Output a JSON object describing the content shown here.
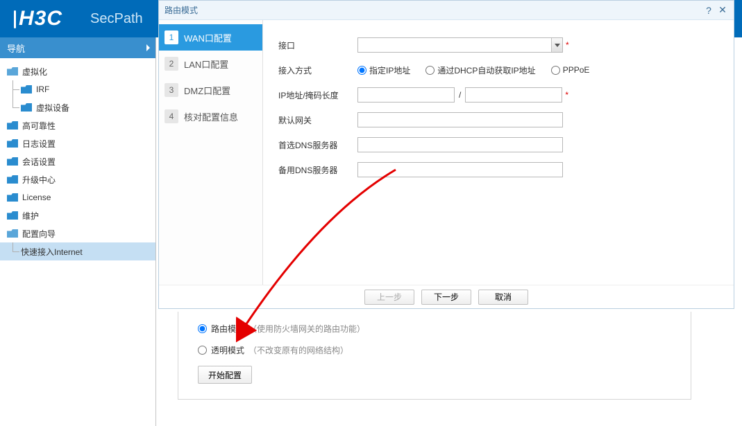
{
  "header": {
    "logo": "H3C",
    "product": "SecPath"
  },
  "sidebar": {
    "nav_title": "导航",
    "items": [
      {
        "label": "虚拟化",
        "children": [
          "IRF",
          "虚拟设备"
        ]
      },
      {
        "label": "高可靠性"
      },
      {
        "label": "日志设置"
      },
      {
        "label": "会话设置"
      },
      {
        "label": "升级中心"
      },
      {
        "label": "License"
      },
      {
        "label": "维护"
      },
      {
        "label": "配置向导",
        "children": [
          "快速接入Internet"
        ]
      }
    ]
  },
  "dialog": {
    "title": "路由模式",
    "steps": [
      {
        "num": "1",
        "label": "WAN口配置"
      },
      {
        "num": "2",
        "label": "LAN口配置"
      },
      {
        "num": "3",
        "label": "DMZ口配置"
      },
      {
        "num": "4",
        "label": "核对配置信息"
      }
    ],
    "form": {
      "labels": {
        "interface": "接口",
        "access": "接入方式",
        "ip": "IP地址/掩码长度",
        "gateway": "默认网关",
        "dns1": "首选DNS服务器",
        "dns2": "备用DNS服务器"
      },
      "access_options": {
        "a": "指定IP地址",
        "b": "通过DHCP自动获取IP地址",
        "c": "PPPoE"
      },
      "slash": "/"
    },
    "buttons": {
      "prev": "上一步",
      "next": "下一步",
      "cancel": "取消"
    }
  },
  "bottom": {
    "route": {
      "label": "路由模式",
      "desc": "（使用防火墙网关的路由功能）"
    },
    "transparent": {
      "label": "透明模式",
      "desc": "（不改变原有的网络结构）"
    },
    "start": "开始配置"
  }
}
